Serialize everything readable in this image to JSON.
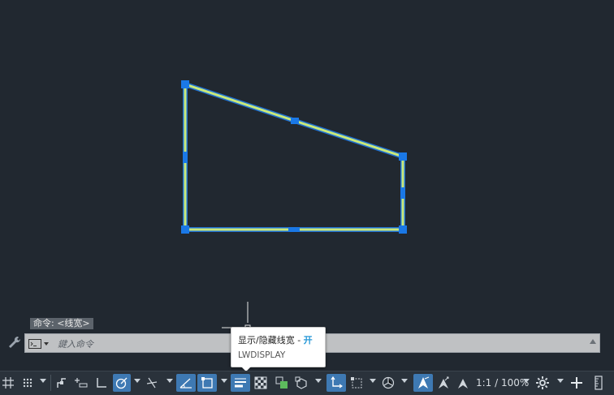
{
  "command_history": "命令: <线宽>",
  "command_line": {
    "placeholder": "鍵入命令"
  },
  "tooltip": {
    "title": "显示/隐藏线宽 - ",
    "state": "开",
    "command": "LWDISPLAY"
  },
  "status_bar": {
    "annotation_scale": "1:1 / 100%"
  },
  "colors": {
    "background": "#212830",
    "polyline": "#c9e87a",
    "grip": "#1a78e6",
    "active_button": "#3e79b3"
  }
}
